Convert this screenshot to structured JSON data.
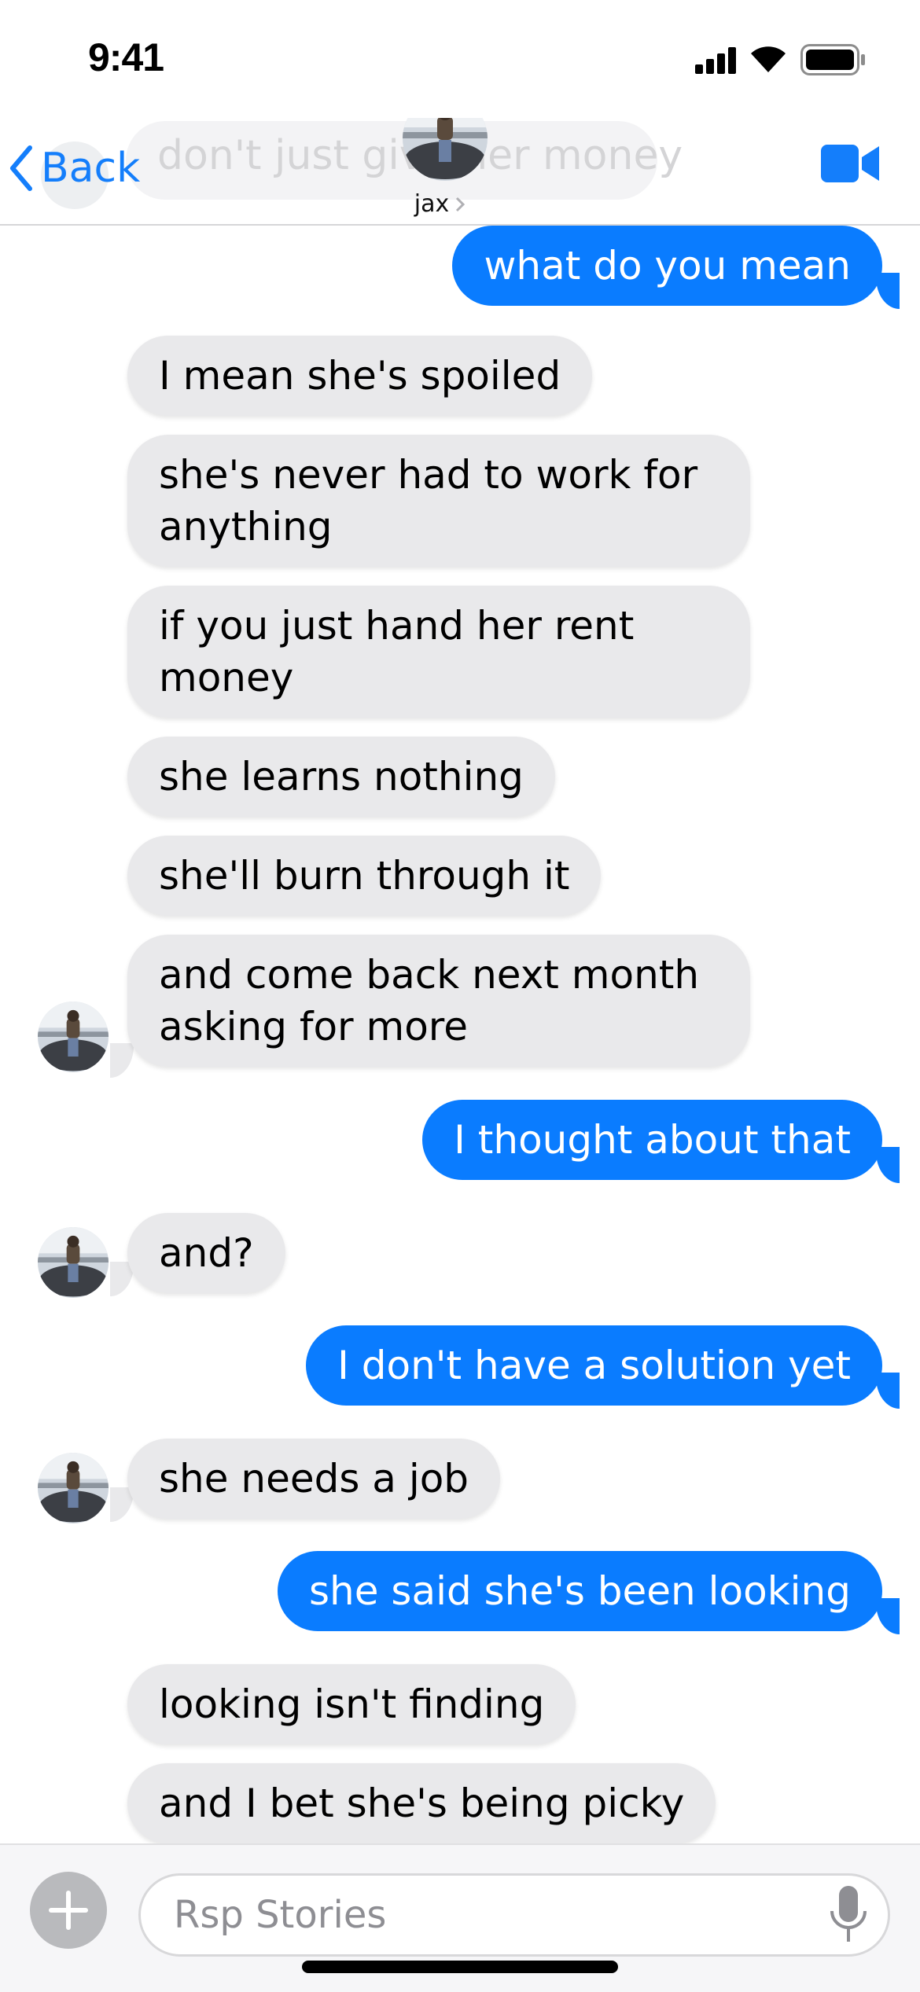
{
  "status_bar": {
    "time": "9:41",
    "icons": [
      "cellular-signal-icon",
      "wifi-icon",
      "battery-icon"
    ]
  },
  "header": {
    "back_label": "Back",
    "contact_name": "jax",
    "ghost_preview_text": "don't just give her money",
    "video_call_icon": "video-camera-icon",
    "accent_color": "#147efb"
  },
  "messages": [
    {
      "from": "me",
      "text": "what do you mean"
    },
    {
      "from": "them",
      "text": "I mean she's spoiled"
    },
    {
      "from": "them",
      "text": "she's never had to work for anything"
    },
    {
      "from": "them",
      "text": "if you just hand her rent money"
    },
    {
      "from": "them",
      "text": "she learns nothing"
    },
    {
      "from": "them",
      "text": "she'll burn through it"
    },
    {
      "from": "them",
      "text": "and come back next month asking for more"
    },
    {
      "from": "me",
      "text": "I thought about that"
    },
    {
      "from": "them",
      "text": "and?"
    },
    {
      "from": "me",
      "text": "I don't have a solution yet"
    },
    {
      "from": "them",
      "text": "she needs a job"
    },
    {
      "from": "me",
      "text": "she said she's been looking"
    },
    {
      "from": "them",
      "text": "looking isn't finding"
    },
    {
      "from": "them",
      "text": "and I bet she's being picky"
    }
  ],
  "composer": {
    "placeholder": "Rsp Stories",
    "add_icon": "plus-icon",
    "mic_icon": "microphone-icon"
  },
  "colors": {
    "outgoing_bubble": "#0a7cff",
    "incoming_bubble": "#e9e9eb"
  }
}
